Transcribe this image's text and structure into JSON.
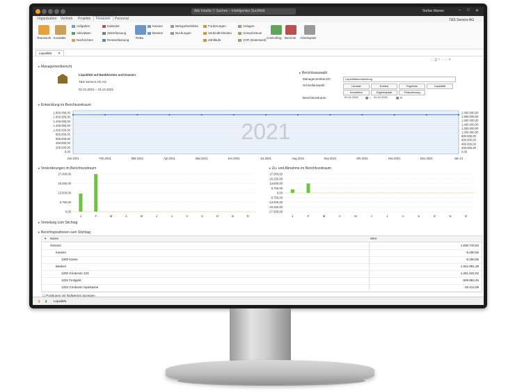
{
  "window": {
    "search_text": "Alle Inhalte ▽  Suchen – Intelligentes Suchfeld",
    "user_name": "Stefan Marion"
  },
  "menu_tabs": [
    "Organisation",
    "Vertrieb",
    "Projekte",
    "Finanzen",
    "Personal"
  ],
  "active_menu_tab": "Finanzen",
  "company": "T&S Service AG",
  "ribbon": {
    "teamwork": "Teamwork",
    "kontakte": "Kontakte",
    "aufgaben": "Aufgaben",
    "aktivitaeten": "Aktivitäten",
    "nachrichten": "Nachrichten",
    "kalender": "Kalender",
    "zeiterfassung": "Zeiterfassung",
    "reiseerfassung": "Reiseerfassung",
    "rebu": "ReBu",
    "kassen": "Kassen",
    "banken": "Banken",
    "belegarbeitsliste": "Belegarbeitsliste",
    "buchungen": "Buchungen",
    "forderungen": "Forderungen",
    "verbindlichkeiten": "Verbindlichkeiten",
    "zahllaeufe": "Zahlläufe",
    "anlagen": "Anlagen",
    "umsatzsteuer": "Umsatzsteuer",
    "vvr": "VVR (Datenweit)",
    "controlling": "Controlling",
    "berichte": "Berichte",
    "arbeitsplatz": "Arbeitsplatz"
  },
  "doc_tab": "Liquidität",
  "management": {
    "section": "Managementbericht",
    "title": "Liquidität auf Bankkonten und Kassen",
    "company": "T&S Service AG AG",
    "period": "01.01.2021 – 31.12.2021"
  },
  "report_select": {
    "section": "Berichtsauswahl",
    "mgmt_label": "Managementbericht",
    "mgmt_value": "Liquiditätsentwicklung",
    "quick_label": "Schnellauswahl",
    "buttons": [
      "Umsatz",
      "Kosten",
      "Ergebnis",
      "Liquidität",
      "Investition",
      "Eigenkapital",
      "Finanzierung"
    ],
    "period_label": "Berichtszeitraum",
    "from": "01.01.2021",
    "to": "31.12.2021"
  },
  "sections": {
    "development": "Entwicklung im Berichtszeitraum",
    "changes": "Veränderungen im Berichtszeitraum",
    "inout": "Zu- und Abnahme im Berichtszeitraum",
    "distribution": "Verteilung zum Stichtag",
    "positions": "Berichtspositionen zum Stichtag"
  },
  "chart_data": [
    {
      "type": "line",
      "title": "Entwicklung im Berichtszeitraum",
      "watermark": "2021",
      "x": [
        "Jan.2021",
        "Feb.2021",
        "Mär.2021",
        "Apr.2021",
        "Mai.2021",
        "Jun.2021",
        "Jul.2021",
        "Aug.2021",
        "Sep.2021",
        "Okt.2021",
        "Nov.2021",
        "Dez.2021",
        "Jan.21"
      ],
      "y_ticks": [
        "1.800.000,00",
        "1.600.000,00",
        "1.400.000,00",
        "1.200.000,00",
        "1.000.000,00",
        "800.000,00",
        "600.000,00",
        "400.000,00",
        "200.000,00",
        "0,00"
      ],
      "y_ticks_right": [
        "2.000.000,00",
        "1.800.000,00",
        "1.600.000,00",
        "1.400.000,00",
        "1.200.000,00",
        "1.000.000,00",
        "800.000,00",
        "600.000,00",
        "400.000,00",
        "200.000,00",
        "0,00"
      ],
      "values": [
        1810000,
        1812000,
        1813000,
        1813000,
        1813000,
        1812000,
        1812000,
        1812000,
        1812000,
        1812000,
        1812000,
        1812000,
        1813000
      ],
      "ylim": [
        0,
        2000000
      ]
    },
    {
      "type": "bar",
      "title": "Veränderungen im Berichtszeitraum",
      "categories": [
        "J",
        "F",
        "M",
        "A",
        "M",
        "J",
        "J",
        "A",
        "S",
        "O",
        "N",
        "D"
      ],
      "values": [
        13000,
        27000,
        0,
        0,
        0,
        0,
        0,
        0,
        0,
        0,
        0,
        0
      ],
      "y_ticks": [
        "27.000,00",
        "20.250,00",
        "13.500,00",
        "6.750,00",
        "0,00"
      ],
      "ylim": [
        0,
        27000
      ]
    },
    {
      "type": "bar",
      "title": "Zu- und Abnahme im Berichtszeitraum",
      "categories": [
        "J",
        "F",
        "M",
        "A",
        "M",
        "J",
        "J",
        "A",
        "S",
        "O",
        "N",
        "D"
      ],
      "values": [
        5000,
        13500,
        0,
        0,
        0,
        0,
        0,
        0,
        0,
        0,
        0,
        0
      ],
      "y_ticks": [
        "27.000,00",
        "20.250,00",
        "13.500,00",
        "6.750,00",
        "0,00",
        "-6.750,00",
        "-13.500,00",
        "-20.250,00",
        "-27.000,00"
      ],
      "ylim": [
        -27000,
        27000
      ]
    }
  ],
  "table": {
    "col_name": "Name",
    "col_value": "Wert",
    "rows": [
      {
        "name": "Gesamt",
        "value": "1.836.740,83",
        "indent": 0
      },
      {
        "name": "Kassen",
        "value": "-6.250,55",
        "indent": 1
      },
      {
        "name": "1000 Kasse",
        "value": "-6.250,55",
        "indent": 2
      },
      {
        "name": "Banken",
        "value": "1.842.991,38",
        "indent": 1
      },
      {
        "name": "1200 Girokonto 123",
        "value": "1.251.522,02",
        "indent": 2
      },
      {
        "name": "1201 Festgeld",
        "value": "609.883,45",
        "indent": 2
      },
      {
        "name": "1202 Girokonto Sparkasse",
        "value": "-18.414,09",
        "indent": 2
      }
    ],
    "checkbox_label": "Positionen mit Nullwerten anzeigen"
  },
  "status": {
    "label": "Liquidität"
  }
}
